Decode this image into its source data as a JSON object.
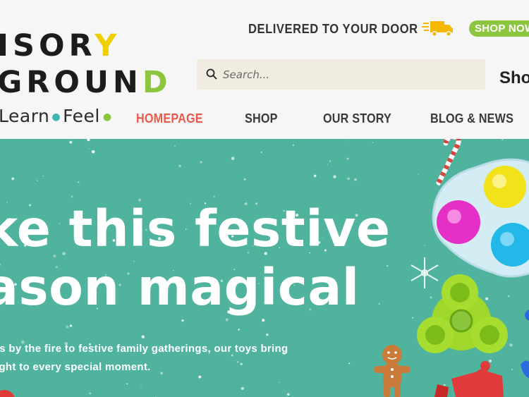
{
  "logo": {
    "line1_pre": "ISOR",
    "line1_hl": "Y",
    "line2_pre": "GROUN",
    "line2_hl": "D",
    "tag_a": "Learn",
    "tag_b": "Feel"
  },
  "topbar": {
    "delivery": "DELIVERED TO YOUR DOOR",
    "shop_now": "SHOP NOW"
  },
  "search": {
    "placeholder": "Search...",
    "shop_partial": "Shop"
  },
  "nav": {
    "items": [
      {
        "label": "HOMEPAGE",
        "active": true
      },
      {
        "label": "SHOP",
        "active": false
      },
      {
        "label": "OUR STORY",
        "active": false
      },
      {
        "label": "BLOG & NEWS",
        "active": false
      }
    ]
  },
  "hero": {
    "title_line1": "ke this festive",
    "title_line2": "ason magical",
    "desc_line1": "ts by the fire to festive family gatherings, our toys bring",
    "desc_line2": "ight to every special moment."
  },
  "colors": {
    "accent_red": "#e85b4a",
    "accent_green": "#8cc63f",
    "accent_yellow": "#f0cf00",
    "hero_bg": "#4fb39e"
  }
}
